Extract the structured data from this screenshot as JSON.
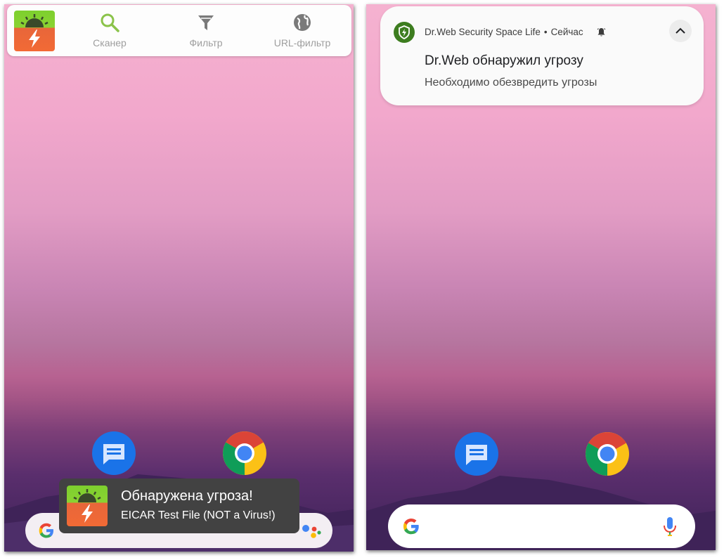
{
  "left_screen": {
    "quick_panel": {
      "items": [
        {
          "label": "Сканер",
          "icon": "search-icon",
          "color": "#8bc34a"
        },
        {
          "label": "Фильтр",
          "icon": "filter-icon"
        },
        {
          "label": "URL-фильтр",
          "icon": "globe-icon"
        }
      ]
    },
    "dock": {
      "apps": [
        {
          "icon": "messages-icon"
        },
        {
          "icon": "chrome-icon"
        }
      ]
    },
    "toast": {
      "title": "Обнаружена угроза!",
      "text": "EICAR Test File (NOT a Virus!)"
    }
  },
  "right_screen": {
    "notification": {
      "app_name": "Dr.Web Security Space Life",
      "time": "Сейчас",
      "title": "Dr.Web обнаружил угрозу",
      "text": "Необходимо обезвредить угрозы",
      "icons": [
        "shield-icon",
        "bell-icon",
        "chevron-up-icon"
      ],
      "accent_color": "#3d7d1f"
    },
    "dock": {
      "apps": [
        {
          "icon": "messages-icon"
        },
        {
          "icon": "chrome-icon"
        }
      ]
    },
    "search_bar": {
      "icons": [
        "google-g-icon",
        "microphone-icon"
      ]
    }
  }
}
